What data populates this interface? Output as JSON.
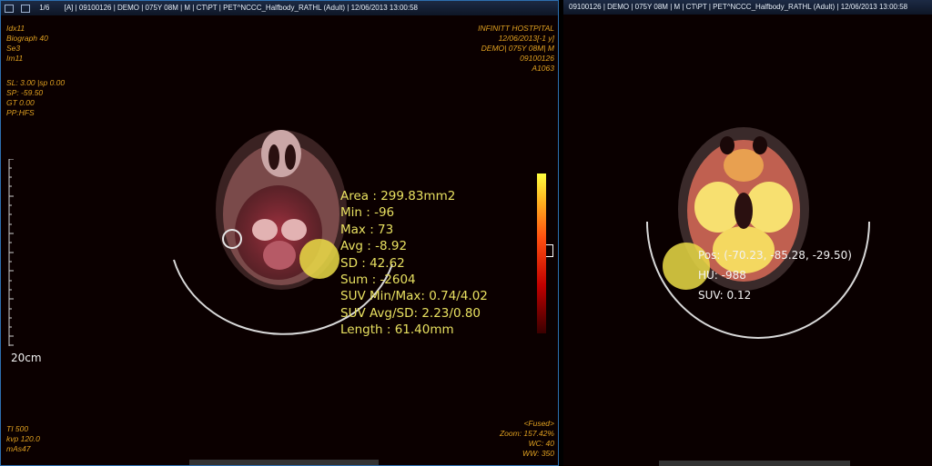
{
  "left_viewport": {
    "titlebar": {
      "page_indicator": "1/6",
      "text": "[A] | 09100126 | DEMO | 075Y 08M | M | CT\\PT | PET^NCCC_Halfbody_RATHL (Adult) | 12/06/2013 13:00:58"
    },
    "top_left": [
      "Idx11",
      "Biograph 40",
      "Se3",
      "Im11"
    ],
    "acq_params": [
      "SL: 3.00 |sp 0.00",
      "SP: -59.50",
      "GT 0.00",
      "PP:HFS"
    ],
    "top_right": [
      "INFINITT HOSTPITAL",
      "12/06/2013[-1 y]",
      "DEMO| 075Y 08M| M",
      "09100126",
      "A1063"
    ],
    "bottom_left": [
      "TI 500",
      "kvp 120.0",
      "mAs47"
    ],
    "bottom_right": [
      "<Fused>",
      "Zoom: 157.42%",
      "WC: 40",
      "WW: 350"
    ],
    "scale_label": "20cm",
    "measurement": [
      "Area : 299.83mm2",
      "Min : -96",
      "Max : 73",
      "Avg : -8.92",
      "SD : 42.62",
      "Sum : -2604",
      "SUV Min/Max: 0.74/4.02",
      "SUV Avg/SD: 2.23/0.80",
      "Length : 61.40mm"
    ]
  },
  "right_viewport": {
    "titlebar": {
      "text": "09100126 | DEMO | 075Y 08M | M | CT\\PT | PET^NCCC_Halfbody_RATHL (Adult) | 12/06/2013 13:00:58"
    },
    "probe": [
      "Pos: (-70.23, -85.28, -29.50)",
      "HU: -988",
      "SUV: 0.12"
    ]
  },
  "colors": {
    "overlay_text": "#e0a020",
    "measurement_text": "#e8e060",
    "roi_fill": "#ebdc46",
    "frame_border": "#2d6fb0"
  },
  "icons": [
    "grid-layout-icon",
    "series-icon"
  ]
}
